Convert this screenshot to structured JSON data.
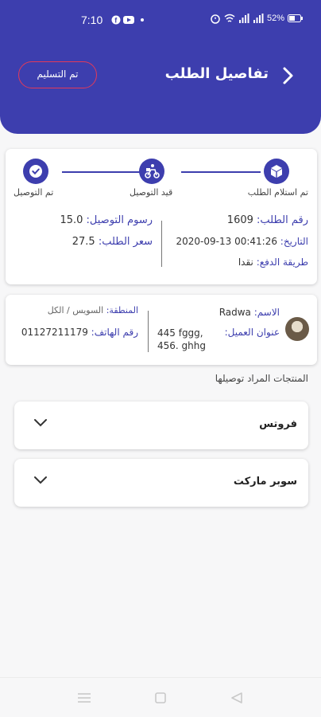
{
  "status_bar": {
    "time": "7:10",
    "battery": "52%"
  },
  "header": {
    "title": "تفاصيل الطلب",
    "status_label": "تم التسليم",
    "color": "#3d3eae",
    "pill_border_color": "#e23a5a"
  },
  "steps": [
    {
      "label": "تم استلام الطلب",
      "icon": "box-icon"
    },
    {
      "label": "قيد التوصيل",
      "icon": "delivery-bike-icon"
    },
    {
      "label": "تم التوصيل",
      "icon": "check-circle-icon"
    }
  ],
  "order": {
    "number_key": "رقم الطلب:",
    "number_value": "1609",
    "date_key": "التاريخ:",
    "date_value": "2020-09-13 00:41:26",
    "payment_key": "طريقة الدفع:",
    "payment_value": "نقدا",
    "delivery_fee_key": "رسوم التوصيل:",
    "delivery_fee_value": "15.0",
    "price_key": "سعر الطلب:",
    "price_value": "27.5"
  },
  "customer": {
    "name_key": "الاسم:",
    "name_value": "Radwa",
    "address_key": "عنوان العميل:",
    "address_line1": "445 fggg,",
    "address_line2": "456. ghhg",
    "region_key": "المنطقة:",
    "region_value": "السويس / الكل",
    "phone_key": "رقم الهاتف:",
    "phone_value": "01127211179"
  },
  "products_title": "المنتجات المراد توصيلها",
  "stores": [
    {
      "name": "فروتس"
    },
    {
      "name": "سوبر ماركت"
    }
  ]
}
